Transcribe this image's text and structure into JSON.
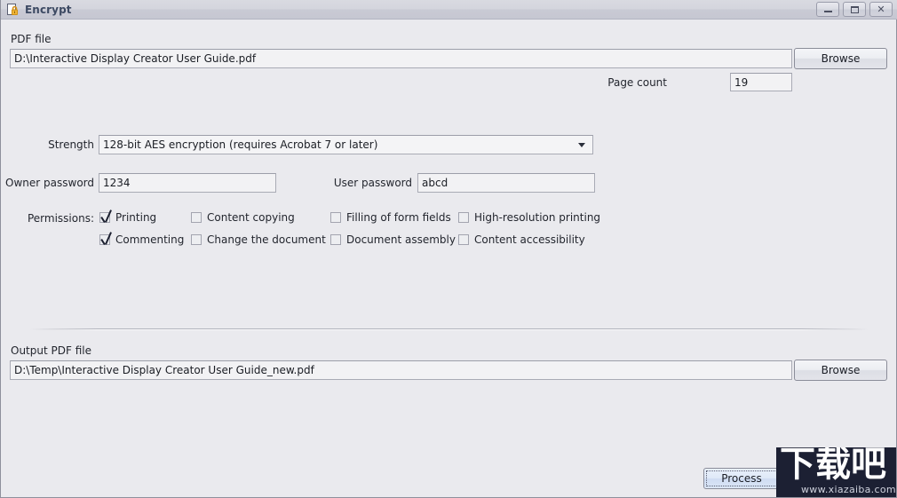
{
  "window": {
    "title": "Encrypt",
    "icon": "lock-document-icon",
    "controls": {
      "minimize": "Minimize",
      "maximize": "Maximize",
      "close": "Close"
    }
  },
  "pdf_file": {
    "label": "PDF file",
    "value": "D:\\Interactive Display Creator User Guide.pdf",
    "browse_label": "Browse"
  },
  "page_count": {
    "label": "Page count",
    "value": "19"
  },
  "strength": {
    "label": "Strength",
    "value": "128-bit AES encryption (requires Acrobat 7 or later)",
    "options": [
      "128-bit AES encryption (requires Acrobat 7 or later)"
    ]
  },
  "owner_password": {
    "label": "Owner password",
    "value": "1234"
  },
  "user_password": {
    "label": "User password",
    "value": "abcd"
  },
  "permissions": {
    "label": "Permissions:",
    "items": [
      {
        "label": "Printing",
        "checked": true
      },
      {
        "label": "Content copying",
        "checked": false
      },
      {
        "label": "Filling of form fields",
        "checked": false
      },
      {
        "label": "High-resolution printing",
        "checked": false
      },
      {
        "label": "Commenting",
        "checked": true
      },
      {
        "label": "Change the document",
        "checked": false
      },
      {
        "label": "Document assembly",
        "checked": false
      },
      {
        "label": "Content accessibility",
        "checked": false
      }
    ]
  },
  "output_pdf_file": {
    "label": "Output PDF file",
    "value": "D:\\Temp\\Interactive Display Creator User Guide_new.pdf",
    "browse_label": "Browse"
  },
  "process": {
    "label": "Process"
  },
  "watermark": {
    "logo_text": "下载吧",
    "url": "www.xiazaiba.com"
  },
  "colors": {
    "window_background": "#eaeaee",
    "titlebar_top": "#d9dae1",
    "titlebar_bottom": "#c6c7d2",
    "title_text": "#3d4a63",
    "lock_icon": "#e8a317",
    "focus_button": "#dfe9f8",
    "watermark_background": "#1c2033"
  }
}
